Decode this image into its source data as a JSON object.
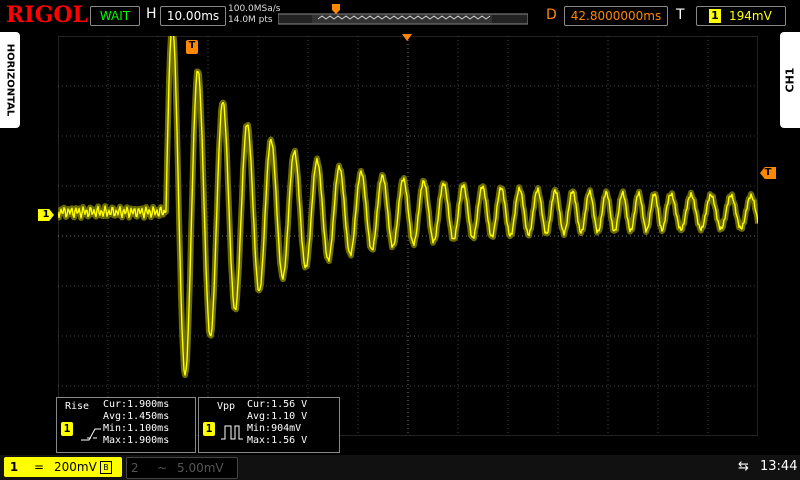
{
  "header": {
    "logo": "RIGOL",
    "run_status": "WAIT",
    "horizontal_label": "H",
    "timebase": "10.00ms",
    "sample_rate": "100.0MSa/s",
    "memory_depth": "14.0M pts",
    "delay_label": "D",
    "delay": "42.8000000ms",
    "trigger_label": "T",
    "trigger_icon": "1",
    "trigger_level": "194mV"
  },
  "sidebar": {
    "left_tab": "HORIZONTAL",
    "right_tab": "CH1"
  },
  "markers": {
    "trigger_pos": "T",
    "ch1_offset": "1",
    "trigger_level": "T"
  },
  "measurements": [
    {
      "name": "Rise",
      "badge": "1",
      "rows": [
        "Cur:1.900ms",
        "Avg:1.450ms",
        "Min:1.100ms",
        "Max:1.900ms"
      ]
    },
    {
      "name": "Vpp",
      "badge": "1",
      "rows": [
        "Cur:1.56 V",
        "Avg:1.10 V",
        "Min:904mV",
        "Max:1.56 V"
      ]
    }
  ],
  "bottom": {
    "ch1": {
      "number": "1",
      "coupling": "=",
      "scale": "200mV",
      "bw_icon": "B"
    },
    "ch2": {
      "number": "2",
      "coupling": "~",
      "scale": "5.00mV"
    },
    "clock": "13:44"
  },
  "colors": {
    "trace": "#ffff00",
    "grid": "#555555",
    "accent_orange": "#ff8800"
  }
}
